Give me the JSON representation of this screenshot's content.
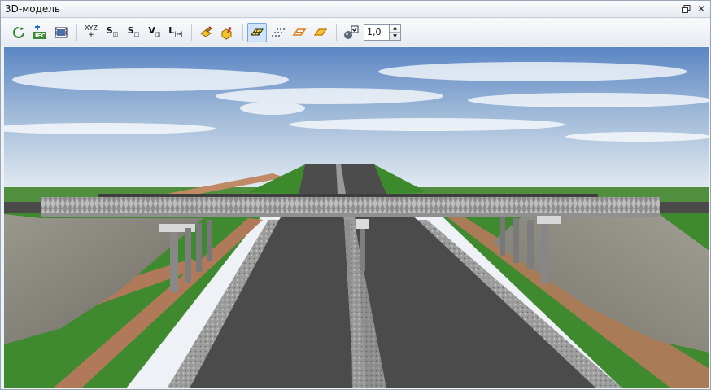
{
  "window": {
    "title": "3D-модель"
  },
  "title_buttons": {
    "float_icon": "restore-window-icon",
    "close_icon": "close-icon"
  },
  "toolbar": {
    "xyz_label": "XYZ",
    "s_area_label": "S",
    "s_surface_label": "S",
    "v_volume_label": "V",
    "l_length_label": "L",
    "scale_value": "1,0"
  },
  "colors": {
    "sky_top": "#5c87c4",
    "sky_bottom": "#dce6ef",
    "grass": "#3f8a2f",
    "asphalt": "#4b4b4b",
    "gravel": "#9a9a9a",
    "soil": "#b07a5a",
    "slope": "#8f8c82",
    "bridge": "#a9a9a9"
  }
}
